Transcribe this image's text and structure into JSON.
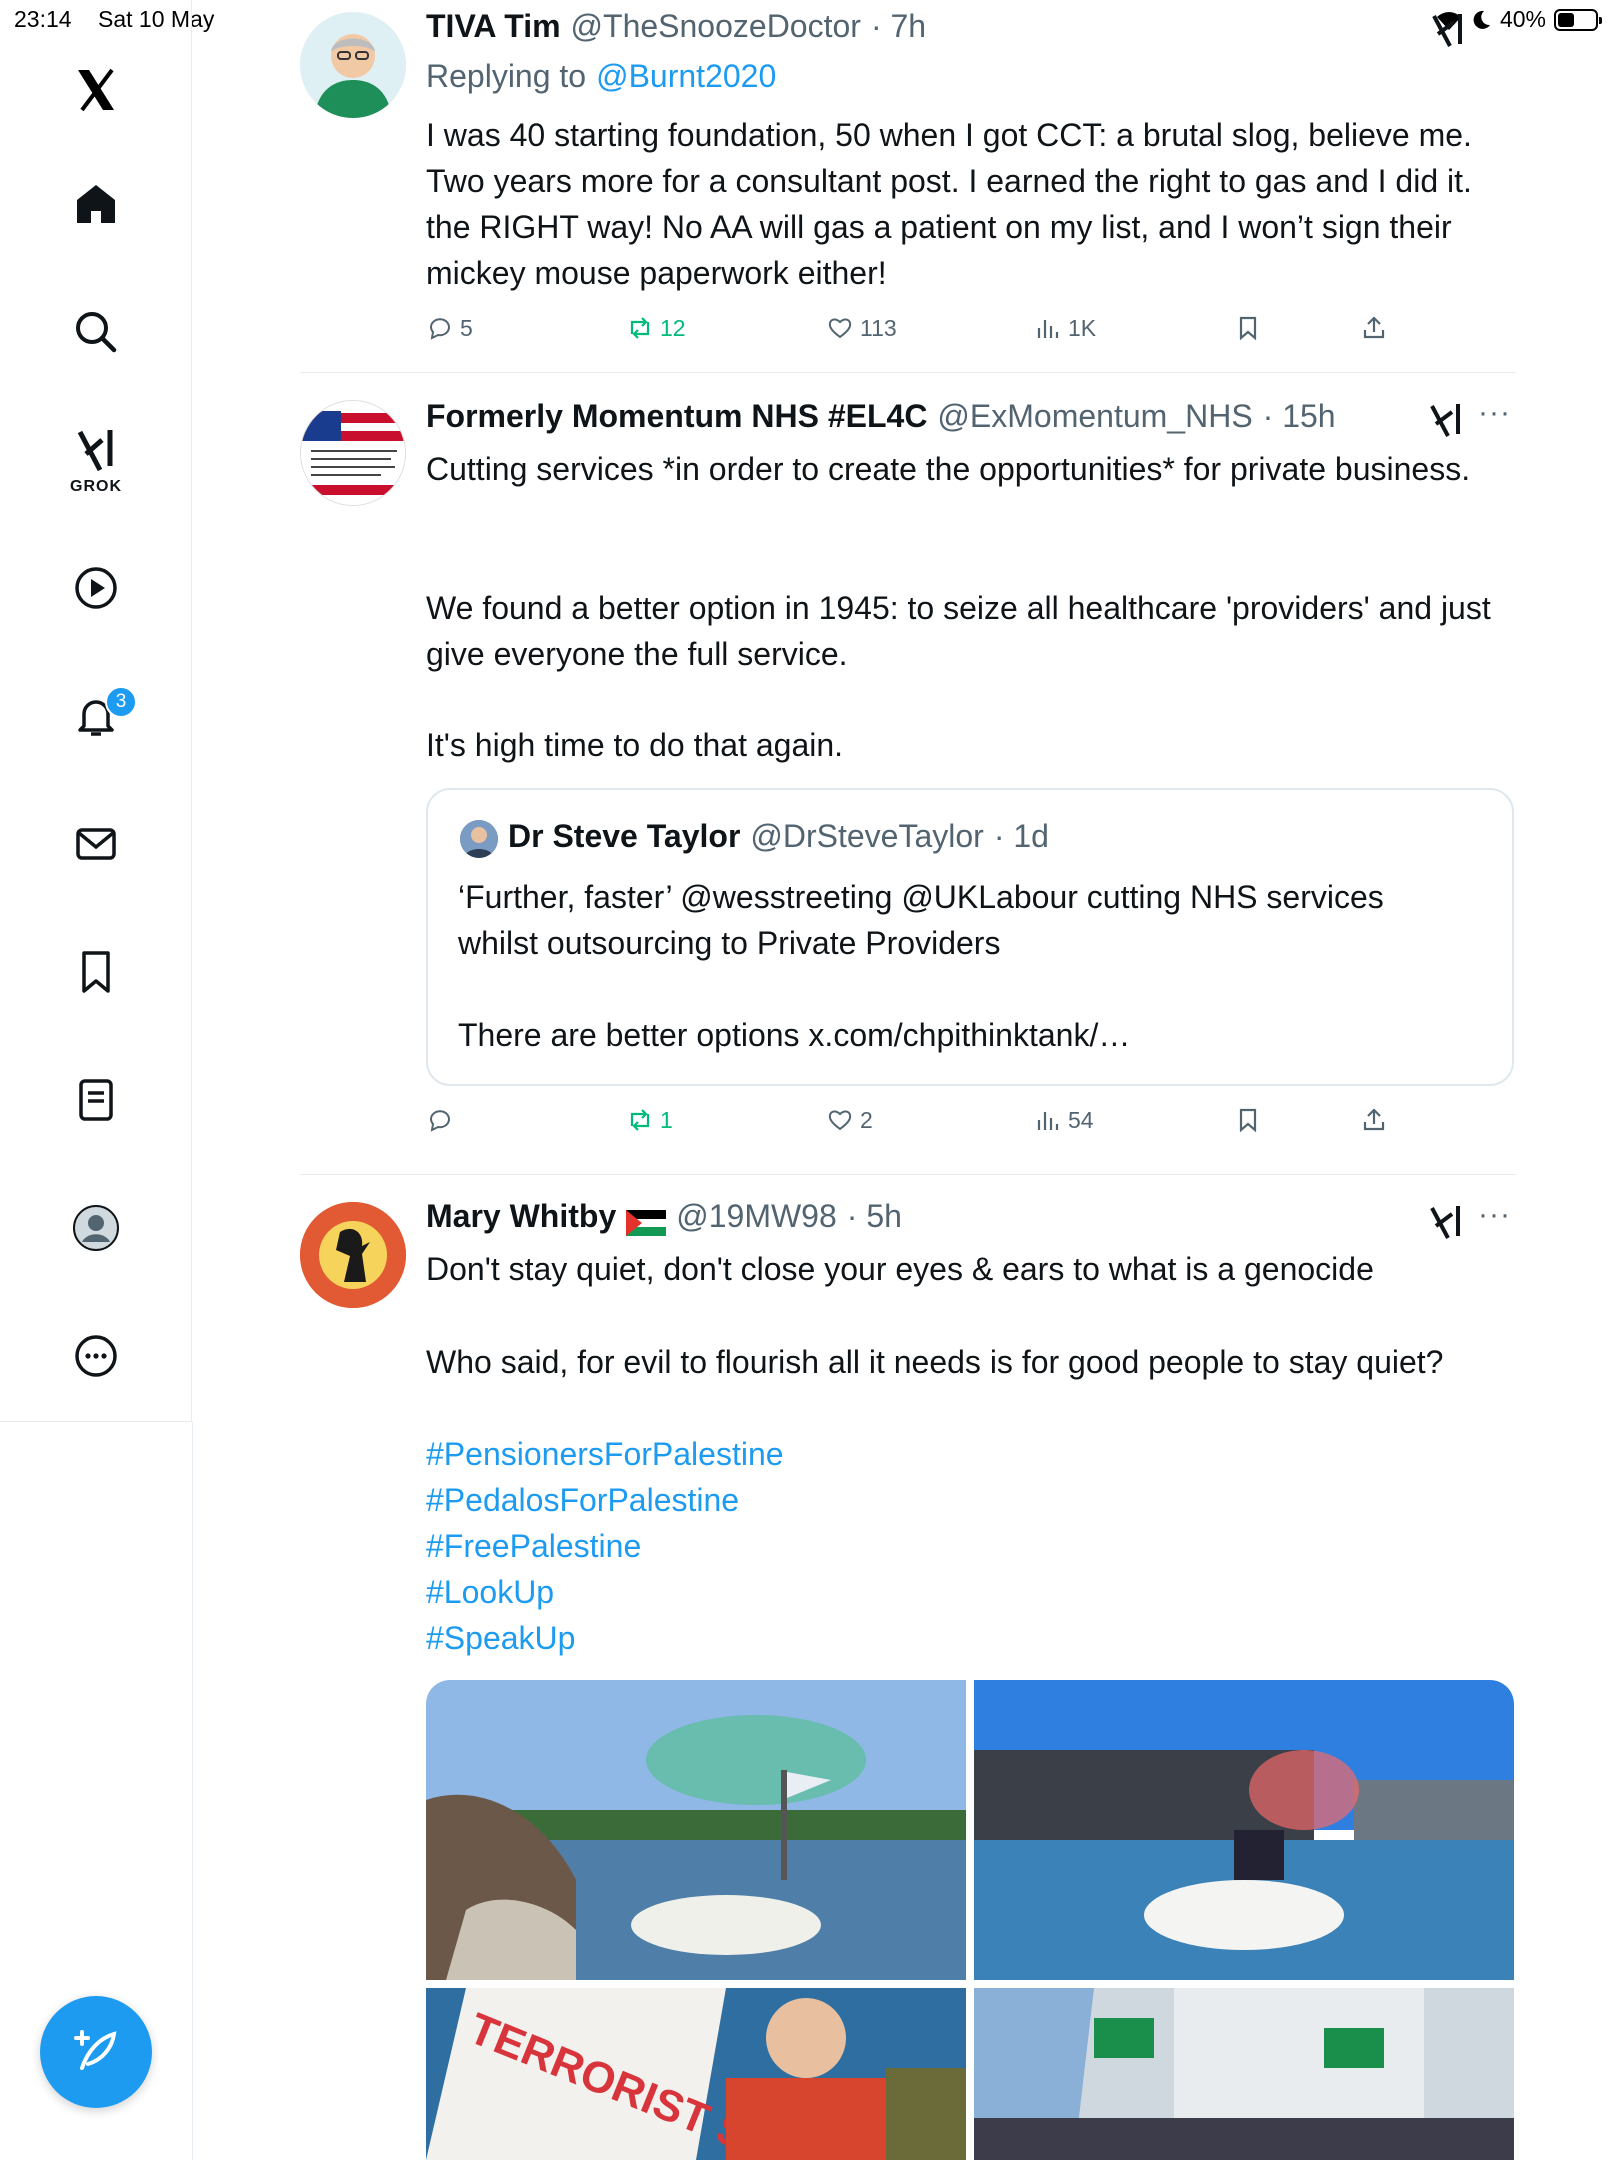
{
  "status_bar": {
    "time": "23:14",
    "date": "Sat 10 May",
    "battery": "40%"
  },
  "sidebar": {
    "items": [
      {
        "icon": "x-logo-icon"
      },
      {
        "icon": "home-icon"
      },
      {
        "icon": "search-icon"
      },
      {
        "icon": "grok-icon",
        "label": "GROK"
      },
      {
        "icon": "video-play-icon"
      },
      {
        "icon": "notifications-bell-icon",
        "badge": "3"
      },
      {
        "icon": "messages-envelope-icon"
      },
      {
        "icon": "bookmark-icon"
      },
      {
        "icon": "lists-icon"
      },
      {
        "icon": "profile-avatar-icon"
      },
      {
        "icon": "more-circle-icon"
      }
    ],
    "compose_icon": "compose-feather-icon"
  },
  "colors": {
    "accent": "#1d9bf0",
    "retweet_green": "#00ba7c",
    "secondary_text": "#536471"
  },
  "tweets": [
    {
      "name": "TIVA Tim",
      "handle": "@TheSnoozeDoctor",
      "time": "· 7h",
      "reply_prefix": "Replying to",
      "reply_to": "@Burnt2020",
      "text": "I was 40 starting foundation, 50 when I got CCT: a brutal slog, believe me. Two years more for a consultant post. I earned the right to gas and I did it. the RIGHT way! No AA will gas a patient on my list, and I won’t sign their mickey mouse paperwork either!",
      "replies": "5",
      "retweets": "12",
      "likes": "113",
      "views": "1K"
    },
    {
      "name": "Formerly Momentum NHS #EL4C",
      "handle": "@ExMomentum_NHS",
      "time": "· 15h",
      "text_lines": [
        "Cutting services *in order to create the opportunities* for private business.",
        "We found a better option in 1945: to seize all healthcare 'providers' and just give everyone the full service.",
        "It's high time to do that again."
      ],
      "quote": {
        "name": "Dr Steve Taylor",
        "handle": "@DrSteveTaylor",
        "time": "· 1d",
        "line1": "‘Further, faster’ @wesstreeting  @UKLabour cutting NHS services whilst outsourcing to Private Providers",
        "line2": "There are better options x.com/chpithinktank/…"
      },
      "replies": "",
      "retweets": "1",
      "likes": "2",
      "views": "54"
    },
    {
      "name": "Mary Whitby",
      "flag": "🇵🇸",
      "handle": "@19MW98",
      "time": "· 5h",
      "line1": "Don't stay quiet, don't close your eyes & ears to what is a genocide",
      "line2": "Who said, for evil to flourish all it needs is for good people to stay quiet?",
      "hashtags": [
        "#PensionersForPalestine",
        "#PedalosForPalestine",
        "#FreePalestine",
        "#LookUp",
        "#SpeakUp"
      ],
      "banner_text": "TERRORIST STATE"
    }
  ]
}
